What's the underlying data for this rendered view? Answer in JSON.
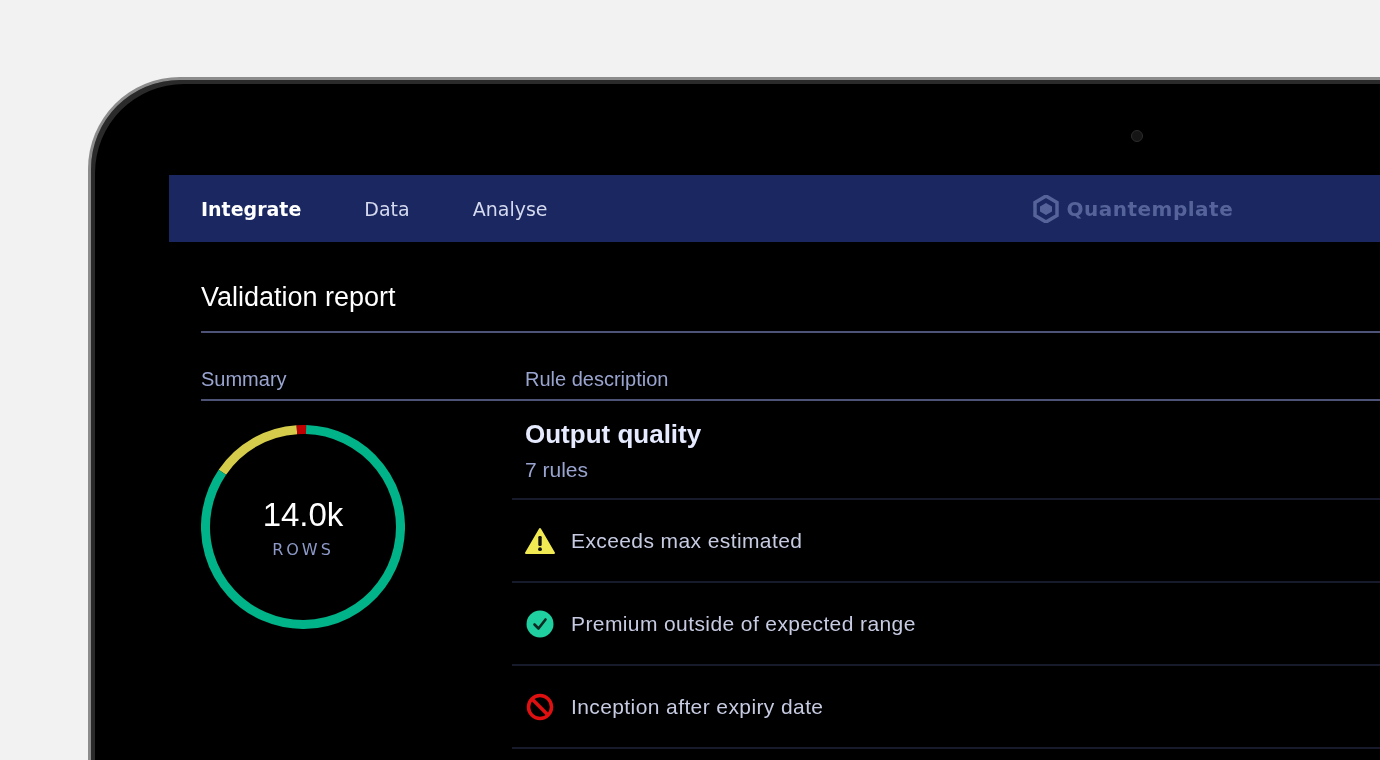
{
  "nav": {
    "tabs": [
      {
        "label": "Integrate",
        "selected": true
      },
      {
        "label": "Data",
        "selected": false
      },
      {
        "label": "Analyse",
        "selected": false
      }
    ],
    "brand": "Quantemplate"
  },
  "page_title": "Validation report",
  "summary": {
    "heading": "Summary",
    "value": "14.0k",
    "unit": "ROWS",
    "segments": [
      {
        "color": "#d4cc4a"
      },
      {
        "color": "#c00000"
      },
      {
        "color": "#00b388"
      }
    ]
  },
  "rules": {
    "heading": "Rule description",
    "group_title": "Output quality",
    "group_count": "7 rules",
    "items": [
      {
        "kind": "warning",
        "label": "Exceeds max estimated"
      },
      {
        "kind": "passed",
        "label": "Premium outside of expected range"
      },
      {
        "kind": "error",
        "label": "Inception after expiry date"
      }
    ]
  }
}
